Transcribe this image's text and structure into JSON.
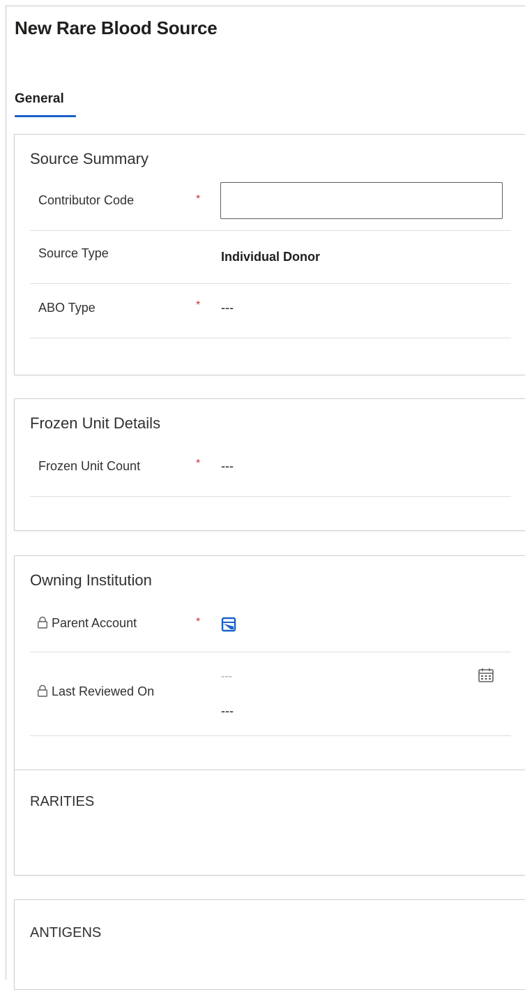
{
  "form": {
    "title": "New Rare Blood Source",
    "tabs": [
      {
        "label": "General",
        "selected": true
      }
    ]
  },
  "sections": {
    "source_summary": {
      "title": "Source Summary",
      "contributor_code": {
        "label": "Contributor Code",
        "required": "*",
        "value": ""
      },
      "source_type": {
        "label": "Source Type",
        "value": "Individual Donor"
      },
      "abo_type": {
        "label": "ABO Type",
        "required": "*",
        "value": "---"
      }
    },
    "frozen_unit_details": {
      "title": "Frozen Unit Details",
      "frozen_unit_count": {
        "label": "Frozen Unit Count",
        "required": "*",
        "value": "---"
      }
    },
    "owning_institution": {
      "title": "Owning Institution",
      "parent_account": {
        "label": "Parent Account",
        "required": "*",
        "icon": "lookup-icon"
      },
      "last_reviewed_on": {
        "label": "Last Reviewed On",
        "date_value": "---",
        "time_value": "---",
        "icon": "calendar-icon"
      }
    },
    "rarities": {
      "title": "RARITIES"
    },
    "antigens": {
      "title": "ANTIGENS"
    }
  },
  "colors": {
    "accent": "#1a62c9",
    "required": "#d13438",
    "border": "#cfcfcf",
    "divider": "#e1dfdd"
  }
}
